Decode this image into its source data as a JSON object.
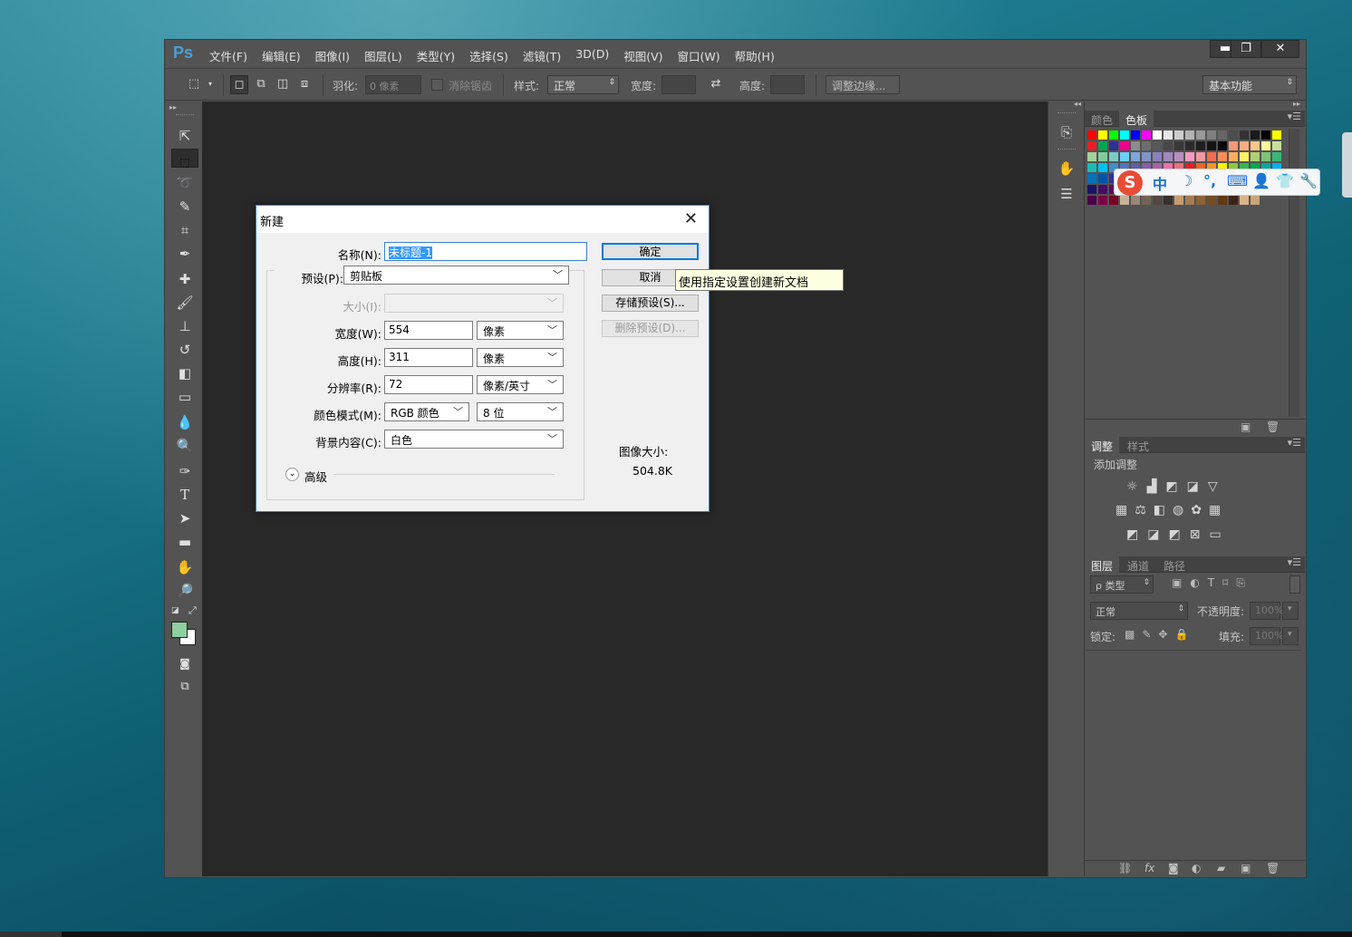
{
  "app": {
    "logo": "Ps"
  },
  "menu": [
    "文件(F)",
    "编辑(E)",
    "图像(I)",
    "图层(L)",
    "类型(Y)",
    "选择(S)",
    "滤镜(T)",
    "3D(D)",
    "视图(V)",
    "窗口(W)",
    "帮助(H)"
  ],
  "window_controls": {
    "minimize": "▬",
    "restore": "❐",
    "close": "✕"
  },
  "options_bar": {
    "feather_label": "羽化:",
    "feather_value": "0 像素",
    "antialias_label": "消除锯齿",
    "style_label": "样式:",
    "style_value": "正常",
    "width_label": "宽度:",
    "height_label": "高度:",
    "refine_edge": "调整边缘...",
    "workspace": "基本功能"
  },
  "tools": [
    "move-tool",
    "marquee-tool",
    "lasso-tool",
    "quick-select-tool",
    "crop-tool",
    "eyedropper-tool",
    "healing-brush-tool",
    "brush-tool",
    "clone-stamp-tool",
    "history-brush-tool",
    "eraser-tool",
    "gradient-tool",
    "blur-tool",
    "dodge-tool",
    "pen-tool",
    "type-tool",
    "path-select-tool",
    "rectangle-tool",
    "hand-tool",
    "zoom-tool"
  ],
  "panels": {
    "color_tabs": [
      "颜色",
      "色板"
    ],
    "adjust_tabs": [
      "调整",
      "样式"
    ],
    "adjust_title": "添加调整",
    "layer_tabs": [
      "图层",
      "通道",
      "路径"
    ],
    "layer_filter": "ρ 类型",
    "blend_mode": "正常",
    "opacity_label": "不透明度:",
    "opacity_value": "100%",
    "lock_label": "锁定:",
    "fill_label": "填充:",
    "fill_value": "100%"
  },
  "dialog": {
    "title": "新建",
    "name_label": "名称(N):",
    "name_value": "未标题-1",
    "preset_label": "预设(P):",
    "preset_value": "剪贴板",
    "size_label": "大小(I):",
    "width_label": "宽度(W):",
    "width_value": "554",
    "width_unit": "像素",
    "height_label": "高度(H):",
    "height_value": "311",
    "height_unit": "像素",
    "resolution_label": "分辨率(R):",
    "resolution_value": "72",
    "resolution_unit": "像素/英寸",
    "color_mode_label": "颜色模式(M):",
    "color_mode_value": "RGB 颜色",
    "bit_depth": "8 位",
    "background_label": "背景内容(C):",
    "background_value": "白色",
    "advanced": "高级",
    "ok": "确定",
    "cancel": "取消",
    "save_preset": "存储预设(S)...",
    "delete_preset": "删除预设(D)...",
    "image_size_label": "图像大小:",
    "image_size_value": "504.8K"
  },
  "tooltip": "使用指定设置创建新文档",
  "ime": {
    "mode": "中"
  },
  "swatch_colors": [
    "#ff0000",
    "#ffff00",
    "#00ff00",
    "#00ffff",
    "#0000ff",
    "#ff00ff",
    "#ffffff",
    "#e6e6e6",
    "#cccccc",
    "#b3b3b3",
    "#999999",
    "#808080",
    "#666666",
    "#4d4d4d",
    "#333333",
    "#1a1a1a",
    "#000000",
    "#ffff00",
    "#ed1c24",
    "#00a651",
    "#2e3192",
    "#ec008c",
    "#8c8c8c",
    "#6e6e6e",
    "#585858",
    "#484848",
    "#393939",
    "#2b2b2b",
    "#1f1f1f",
    "#141414",
    "#0a0a0a",
    "#f7977a",
    "#f9ad81",
    "#fdc68a",
    "#fff79a",
    "#c4df9b",
    "#a3d39c",
    "#82ca9d",
    "#7bcdc8",
    "#6dcff6",
    "#7da7d9",
    "#8393ca",
    "#8781bd",
    "#a187be",
    "#bc8dbf",
    "#f49ac2",
    "#f6989d",
    "#f26c4f",
    "#f68e55",
    "#fbaf5c",
    "#fff467",
    "#acd372",
    "#7cc576",
    "#3bb878",
    "#1abbb4",
    "#00bff3",
    "#438ccb",
    "#5574b9",
    "#605ca8",
    "#855fa8",
    "#a763a8",
    "#f06ea9",
    "#f26d7d",
    "#ed1c24",
    "#f26522",
    "#f7941d",
    "#fff200",
    "#8dc73f",
    "#39b54a",
    "#00a651",
    "#00a99d",
    "#00aeef",
    "#0072bc",
    "#0054a6",
    "#2e3192",
    "#662d91",
    "#92278f",
    "#ec008c",
    "#ed145b",
    "#9e0b0f",
    "#a0410d",
    "#a3620a",
    "#aba000",
    "#598527",
    "#197b30",
    "#007236",
    "#00746b",
    "#0076a3",
    "#004a80",
    "#003471",
    "#1b1464",
    "#440e62",
    "#630460",
    "#9e005d",
    "#9e0039",
    "#790000",
    "#7b2e00",
    "#7d4900",
    "#827b00",
    "#406618",
    "#005e20",
    "#005826",
    "#005952",
    "#005b7f",
    "#003663",
    "#002157",
    "#0d004c",
    "#32004b",
    "#4b0049",
    "#7b0046",
    "#7a0026",
    "#c7b299",
    "#998675",
    "#736357",
    "#534741",
    "#37302d",
    "#c69c6d",
    "#a67c52",
    "#8c6239",
    "#754c24",
    "#603913",
    "#3c2415",
    "#d9b38c",
    "#c9a57a"
  ]
}
